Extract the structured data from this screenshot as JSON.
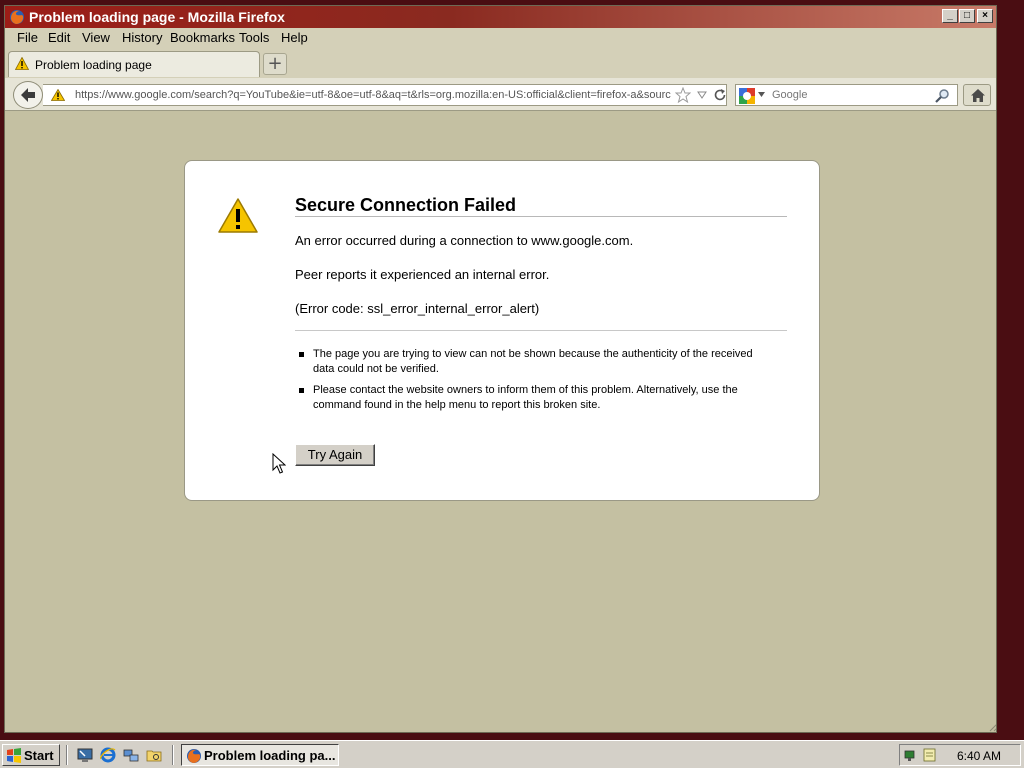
{
  "window": {
    "title": "Problem loading page - Mozilla Firefox",
    "controls": {
      "minimize": "_",
      "maximize": "□",
      "close": "×"
    }
  },
  "menu": [
    "File",
    "Edit",
    "View",
    "History",
    "Bookmarks",
    "Tools",
    "Help"
  ],
  "tabs": [
    {
      "label": "Problem loading page",
      "icon": "warning-icon",
      "active": true
    }
  ],
  "new_tab_label": "+",
  "navbar": {
    "url": "https://www.google.com/search?q=YouTube&ie=utf-8&oe=utf-8&aq=t&rls=org.mozilla:en-US:official&client=firefox-a&source=h",
    "search_placeholder": "Google",
    "search_engine_icon": "google-icon"
  },
  "error": {
    "title": "Secure Connection Failed",
    "lines": [
      "An error occurred during a connection to www.google.com.",
      "Peer reports it experienced an internal error.",
      "(Error code: ssl_error_internal_error_alert)"
    ],
    "bullets": [
      "The page you are trying to view can not be shown because the authenticity of the received data could not be verified.",
      "Please contact the website owners to inform them of this problem. Alternatively, use the command found in the help menu to report this broken site."
    ],
    "button": "Try Again"
  },
  "taskbar": {
    "start_label": "Start",
    "quick_launch": [
      "desktop-icon",
      "ie-icon",
      "network-icon",
      "explorer-icon"
    ],
    "task": {
      "label": "Problem loading pa...",
      "icon": "firefox-icon"
    },
    "clock": "6:40 AM"
  },
  "colors": {
    "titlebar": "#9c1d17",
    "content_background": "#c4c0a2",
    "error_box": "#ffffff",
    "warning_yellow": "#f5c400"
  }
}
